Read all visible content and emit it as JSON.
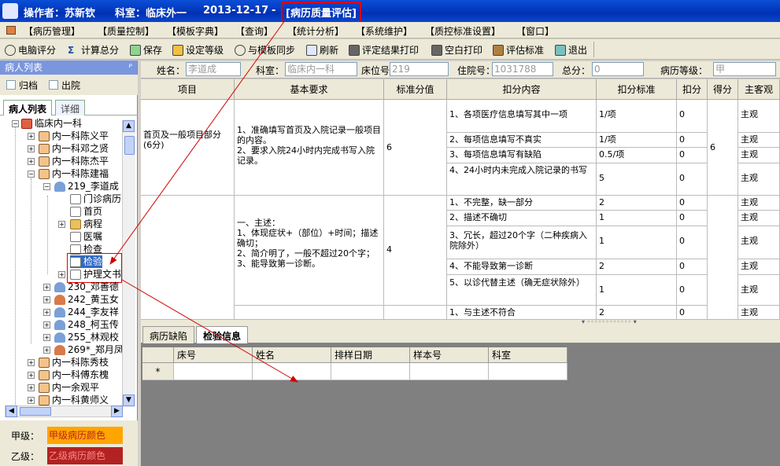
{
  "title": {
    "operator_label": "操作者：苏新钦",
    "dept_label": "科室：临床外一",
    "date": "2013-12-17",
    "dash": "-",
    "module": "[病历质量评估]"
  },
  "menu": [
    "【病历管理】",
    "【质量控制】",
    "【模板字典】",
    "【查询】",
    "【统计分析】",
    "【系统维护】",
    "【质控标准设置】",
    "【窗口】"
  ],
  "toolbar": [
    "电脑评分",
    "计算总分",
    "保存",
    "设定等级",
    "与模板同步",
    "刷新",
    "评定结果打印",
    "空白打印",
    "评估标准",
    "退出"
  ],
  "left_panel": {
    "title": "病人列表",
    "pin": "ᴾ",
    "checks": [
      "归档",
      "出院"
    ],
    "tabs": [
      "病人列表",
      "详细"
    ],
    "tree": [
      "临床内一科",
      "内一科陈义平",
      "内一科邓之贤",
      "内一科陈杰平",
      "内一科陈建福",
      "219_李道成",
      "门诊病历",
      "首页",
      "病程",
      "医嘱",
      "检查",
      "检验",
      "护理文书",
      "230_邓善德",
      "242_黄玉女",
      "244_李友祥",
      "248_柯玉传",
      "255_林观校",
      "269*_郑月凤",
      "内一科陈秀枝",
      "内一科傅东槐",
      "内一余观平",
      "内一科黄师义"
    ],
    "legend": [
      {
        "label": "甲级：",
        "value": "甲级病历颜色",
        "color": "#ffa500"
      },
      {
        "label": "乙级：",
        "value": "乙级病历颜色",
        "color": "#b22222"
      }
    ]
  },
  "info_bar": {
    "name_label": "姓名：",
    "name": "李道成",
    "dept_label": "科室：",
    "dept": "临床内一科",
    "bed_label": "床位号：",
    "bed": "219",
    "admit_label": "住院号：",
    "admit": "1031788",
    "total_label": "总分：",
    "total": "0",
    "grade_label": "病历等级：",
    "grade": "甲"
  },
  "grid": {
    "headers": [
      "项目",
      "基本要求",
      "标准分值",
      "扣分内容",
      "扣分标准",
      "扣分",
      "得分",
      "主客观"
    ],
    "rows": [
      {
        "item": "首页及一般项目部分\n(6分)",
        "requirement": "1、准确填写首页及入院记录一般项目的内容。\n2、要求入院24小时内完成书写入院记录。",
        "standard": "6",
        "score": "6",
        "deductions": [
          {
            "content": "1、各项医疗信息填写其中一项",
            "std": "1/项",
            "ded": "0",
            "type": "主观"
          },
          {
            "content": "2、每项信息填写不真实",
            "std": "1/项",
            "ded": "0",
            "type": "主观"
          },
          {
            "content": "3、每项信息填写有缺陷",
            "std": "0.5/项",
            "ded": "0",
            "type": "主观"
          },
          {
            "content": "4、24小时内未完成入院记录的书写",
            "std": "5",
            "ded": "0",
            "type": "主观"
          }
        ]
      },
      {
        "item": "",
        "requirement": "一、主述：\n1、体现症状+（部位）+时间；描述确切；\n2、简介明了，一般不超过20个字；\n3、能导致第一诊断。",
        "standard": "4",
        "score": "",
        "deductions": [
          {
            "content": "1、不完整，缺一部分",
            "std": "2",
            "ded": "0",
            "type": "主观"
          },
          {
            "content": "2、描述不确切",
            "std": "1",
            "ded": "0",
            "type": "主观"
          },
          {
            "content": "3、冗长，超过20个字（二种疾病入院除外）",
            "std": "1",
            "ded": "0",
            "type": "主观"
          },
          {
            "content": "4、不能导致第一诊断",
            "std": "2",
            "ded": "0",
            "type": "主观"
          },
          {
            "content": "5、以诊代替主述（确无症状除外）",
            "std": "1",
            "ded": "0",
            "type": "主观"
          },
          {
            "content": "1、与主述不符合",
            "std": "2",
            "ded": "0",
            "type": "主观"
          }
        ]
      }
    ]
  },
  "bottom_tabs": [
    "病历缺陷",
    "检验信息"
  ],
  "bottom_grid": {
    "headers": [
      "床号",
      "姓名",
      "排样日期",
      "样本号",
      "科室"
    ],
    "new_row_marker": "*"
  },
  "colors": {
    "title_bg": "#0031b5",
    "highlight_border": "#e00000",
    "arrow": "#d00000"
  }
}
